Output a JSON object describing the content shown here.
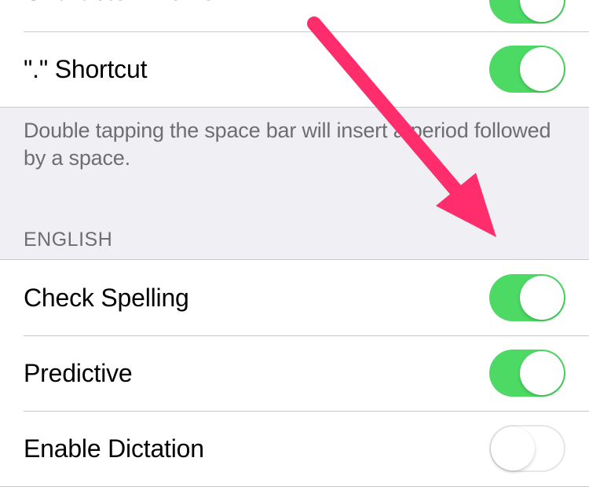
{
  "group_top": {
    "rows": [
      {
        "label": "Character Preview",
        "on": true
      },
      {
        "label": "\".\" Shortcut",
        "on": true
      }
    ],
    "footer": "Double tapping the space bar will insert a period followed by a space."
  },
  "section_header": "ENGLISH",
  "group_english": {
    "rows": [
      {
        "label": "Check Spelling",
        "on": true
      },
      {
        "label": "Predictive",
        "on": true
      },
      {
        "label": "Enable Dictation",
        "on": false
      }
    ]
  },
  "annotation": {
    "color": "#ff2d6b"
  }
}
